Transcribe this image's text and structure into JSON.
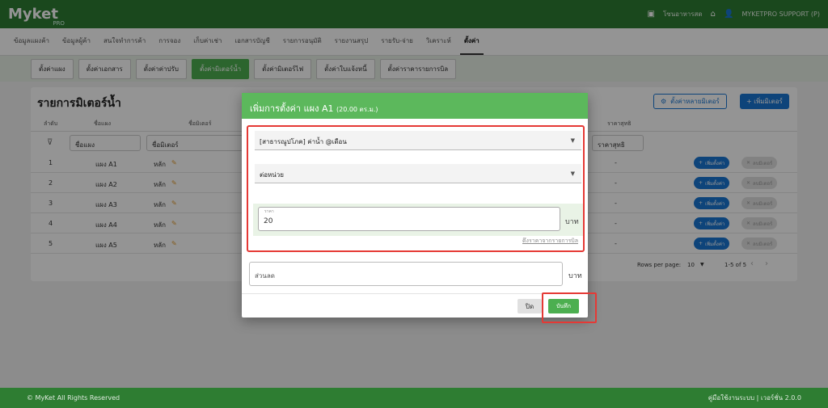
{
  "app": {
    "logo": "Myket",
    "logo_sub": "PRO",
    "top_right": {
      "store_label": "โซนอาหารสด",
      "user_label": "MYKETPRO SUPPORT (P)"
    }
  },
  "main_nav": [
    "ข้อมูลแผงค้า",
    "ข้อมูลผู้ค้า",
    "สนใจทำการค้า",
    "การจอง",
    "เก็บค่าเช่า",
    "เอกสารบัญชี",
    "รายการอนุมัติ",
    "รายงานสรุป",
    "รายรับ-จ่าย",
    "วิเคราะห์",
    "ตั้งค่า"
  ],
  "sub_nav": [
    "ตั้งค่าแผง",
    "ตั้งค่าเอกสาร",
    "ตั้งค่าค่าปรับ",
    "ตั้งค่ามิเตอร์น้ำ",
    "ตั้งค่ามิเตอร์ไฟ",
    "ตั้งค่าใบแจ้งหนี้",
    "ตั้งค่าราคารายการบิล"
  ],
  "page": {
    "title": "รายการมิเตอร์น้ำ",
    "btn_multi": "ตั้งค่าหลายมิเตอร์",
    "btn_add": "+ เพิ่มมิเตอร์",
    "headers": {
      "no": "ลำดับ",
      "stall": "ชื่อแผง",
      "meter": "ชื่อมิเตอร์",
      "net": "ราคาสุทธิ"
    },
    "filters": {
      "stall": "ชื่อแผง",
      "meter": "ชื่อมิเตอร์",
      "net": "ราคาสุทธิ"
    },
    "rows": [
      {
        "no": "1",
        "stall": "แผง A1",
        "meter": "หลัก",
        "net": "-"
      },
      {
        "no": "2",
        "stall": "แผง A2",
        "meter": "หลัก",
        "net": "-"
      },
      {
        "no": "3",
        "stall": "แผง A3",
        "meter": "หลัก",
        "net": "-"
      },
      {
        "no": "4",
        "stall": "แผง A4",
        "meter": "หลัก",
        "net": "-"
      },
      {
        "no": "5",
        "stall": "แผง A5",
        "meter": "หลัก",
        "net": "-"
      }
    ],
    "row_add_label": "เพิ่มตั้งค่า",
    "row_del_label": "ลบมิเตอร์",
    "pager": {
      "rows_per_page_label": "Rows per page:",
      "rows_per_page": "10",
      "range": "1-5 of 5"
    }
  },
  "modal": {
    "title": "เพิ่มการตั้งค่า แผง A1",
    "title_area": "(20.00 ตร.ม.)",
    "select_item": "[สาธารณูปโภค] ค่าน้ำ @เดือน",
    "select_type": "ต่อหน่วย",
    "price_label": "ราคา",
    "price_value": "20",
    "unit": "บาท",
    "link_text": "ดึงราคาจากรายการบิล",
    "discount_placeholder": "ส่วนลด",
    "close_label": "ปิด",
    "save_label": "บันทึก"
  },
  "footer": {
    "left": "© MyKet All Rights Reserved",
    "right": "คู่มือใช้งานระบบ | เวอร์ชั่น 2.0.0"
  },
  "colors": {
    "brand": "#2e7d32",
    "accent": "#4caf50",
    "link": "#1976d2",
    "highlight": "#e53935"
  }
}
